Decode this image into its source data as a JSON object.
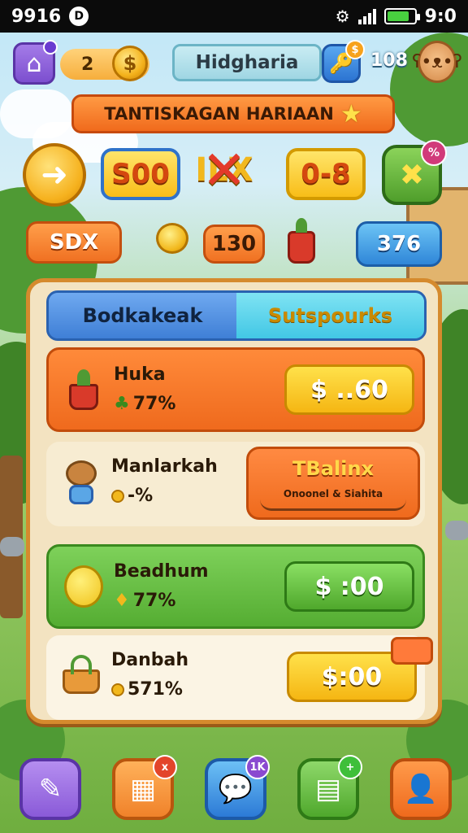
{
  "status_bar": {
    "left_text": "9916",
    "left_icon": "d-circle-icon",
    "time": "9:0",
    "icons": [
      "alarm-icon",
      "signal-icon",
      "battery-icon"
    ]
  },
  "header": {
    "home_icon": "home-icon",
    "coin_count": "2",
    "coin_symbol": "$",
    "title": "Hidgharia",
    "key_badge": "$",
    "gem_count": "108",
    "avatar_icon": "bear-face-icon"
  },
  "banner": {
    "label": "TANTISKAGAN HARIAAN",
    "star_icon": "star-icon"
  },
  "chips": {
    "arrow_icon": "arrow-right-icon",
    "chip1": "S00",
    "chip2": "ILX",
    "chip3": "0-8",
    "x_badge": "%"
  },
  "row2": {
    "left_pill": "SDX",
    "middle_pill": "130",
    "right_pill": "376"
  },
  "tabs": {
    "left": "Bodkakeak",
    "right": "Sutspourks"
  },
  "rows": [
    {
      "name": "Huka",
      "stat": "77%",
      "price": "$ ..60",
      "icon": "plant-pot-icon"
    },
    {
      "name": "Manlarkah",
      "stat": "-%",
      "offer_title": "TBalinx",
      "offer_sub": "Onoonel & Siahita",
      "icon": "bear-icon"
    },
    {
      "name": "Beadhum",
      "stat": "77%",
      "price": "$ :00",
      "icon": "chick-icon"
    },
    {
      "name": "Danbah",
      "stat": "571%",
      "price": "$:00",
      "icon": "basket-icon"
    }
  ],
  "bottom_nav": {
    "items": [
      {
        "icon": "draw-icon"
      },
      {
        "icon": "gift-box-icon",
        "badge": "x"
      },
      {
        "icon": "chat-icon",
        "badge": "1K"
      },
      {
        "icon": "map-add-icon",
        "badge": "+"
      },
      {
        "icon": "profile-icon"
      }
    ]
  }
}
